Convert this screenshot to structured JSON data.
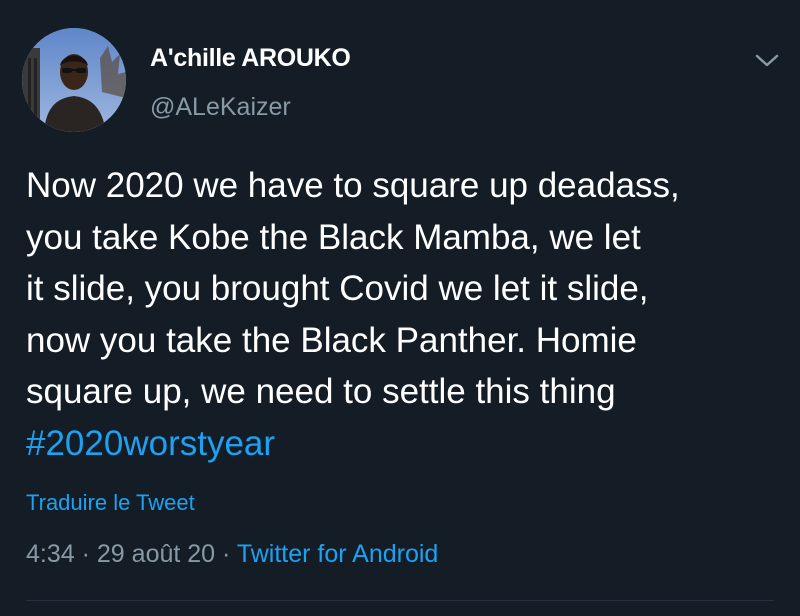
{
  "tweet": {
    "author": {
      "display_name": "A'chille AROUKO",
      "handle": "@ALeKaizer"
    },
    "text_lines": [
      "Now 2020 we have to square up deadass,",
      "you take Kobe the Black Mamba, we let",
      "it slide, you brought Covid we let it slide,",
      "now you take the Black Panther. Homie",
      "square up, we need to settle this thing"
    ],
    "hashtag": "#2020worstyear",
    "translate_label": "Traduire le Tweet",
    "meta": {
      "time": "4:34",
      "separator": "·",
      "date": "29 août 20",
      "source": "Twitter for Android"
    },
    "icons": {
      "menu": "chevron-down-icon",
      "avatar": "profile-photo"
    },
    "colors": {
      "background": "#141d26",
      "text": "#ffffff",
      "secondary": "#8899a6",
      "accent": "#1da1f2"
    }
  }
}
